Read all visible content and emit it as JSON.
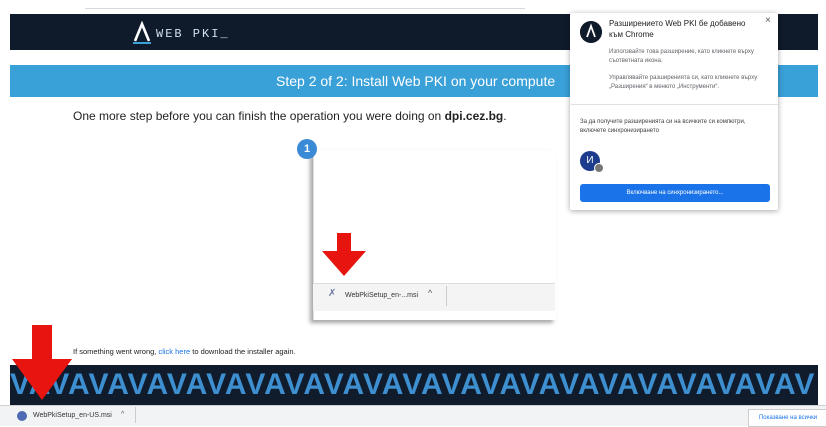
{
  "header": {
    "logo_text": "WEB PKI_",
    "logo_icon": "web-pki-lambda-logo"
  },
  "banner": {
    "title": "Step 2 of 2: Install Web PKI on your compute"
  },
  "intro": {
    "text": "One more step before you can finish the operation you were doing on ",
    "domain": "dpi.cez.bg",
    "suffix": "."
  },
  "illustration": {
    "step_number": "1",
    "file_name": "WebPkiSetup_en-...msi",
    "caret": "^"
  },
  "error_line": {
    "prefix": "If something went wrong, ",
    "link": "click here",
    "suffix": " to download the installer again."
  },
  "pattern": {
    "text": "VAVAVAVAVAVAVAVAVAVAVAVAVAVAVAVAVAVAVAVAV"
  },
  "download_shelf": {
    "file_name": "WebPkiSetup_en-US.msi",
    "caret": "^",
    "show_all": "Показване на всички"
  },
  "extension_popup": {
    "close": "×",
    "title": "Разширението Web PKI бе добавено към Chrome",
    "text1": "Използвайте това разширение, като кликнете върху съответната икона.",
    "text2": "Управлявайте разширенията си, като кликнете върху „Разширения“ в менюто „Инструменти“.",
    "sync_text": "За да получите разширенията си на всичките си компютри, включете синхронизирането",
    "avatar_letter": "И",
    "sync_button": "Включване на синхронизирането..."
  },
  "colors": {
    "header_bg": "#0f1a2b",
    "banner_bg": "#3aa0d8",
    "arrow": "#e8140f",
    "link": "#1a73e8",
    "pattern_text": "#3d8fd0"
  }
}
